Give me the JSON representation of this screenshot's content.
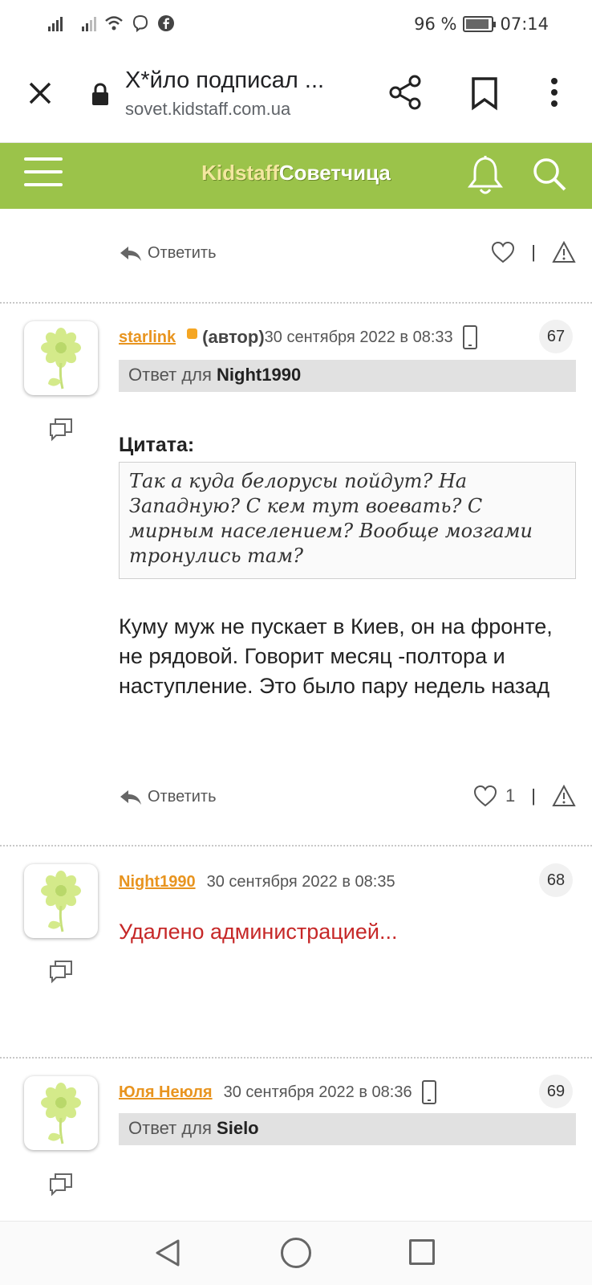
{
  "status_bar": {
    "battery_percent": "96 %",
    "time": "07:14"
  },
  "browser": {
    "tab_title": "Х*йло подписал ...",
    "url": "sovet.kidstaff.com.ua"
  },
  "site": {
    "brand_part1": "Kidstaff",
    "brand_part2": "Советчица"
  },
  "labels": {
    "reply": "Ответить",
    "reply_to_prefix": "Ответ для",
    "quote": "Цитата:",
    "separator": "|"
  },
  "posts": [
    {
      "likes": ""
    },
    {
      "username": "starlink",
      "author_tag": "(автор)",
      "date": "30 сентября 2022 в 08:33",
      "number": "67",
      "reply_to": "Night1990",
      "quote_text": "Так а куда белорусы пойдут? На Западную? С кем тут воевать? С мирным населением? Вообще мозгами тронулись там?",
      "text": "Куму муж не пускает в Киев, он на фронте, не рядовой. Говорит месяц -полтора и наступление. Это было пару недель назад",
      "likes": "1"
    },
    {
      "username": "Night1990",
      "date": "30 сентября 2022 в 08:35",
      "number": "68",
      "deleted_text": "Удалено администрацией..."
    },
    {
      "username": "Юля Неюля",
      "date": "30 сентября 2022 в 08:36",
      "number": "69",
      "reply_to": "Sielo"
    }
  ],
  "colors": {
    "header_bg": "#9bc34a",
    "username": "#e8941f",
    "deleted": "#c62828"
  }
}
